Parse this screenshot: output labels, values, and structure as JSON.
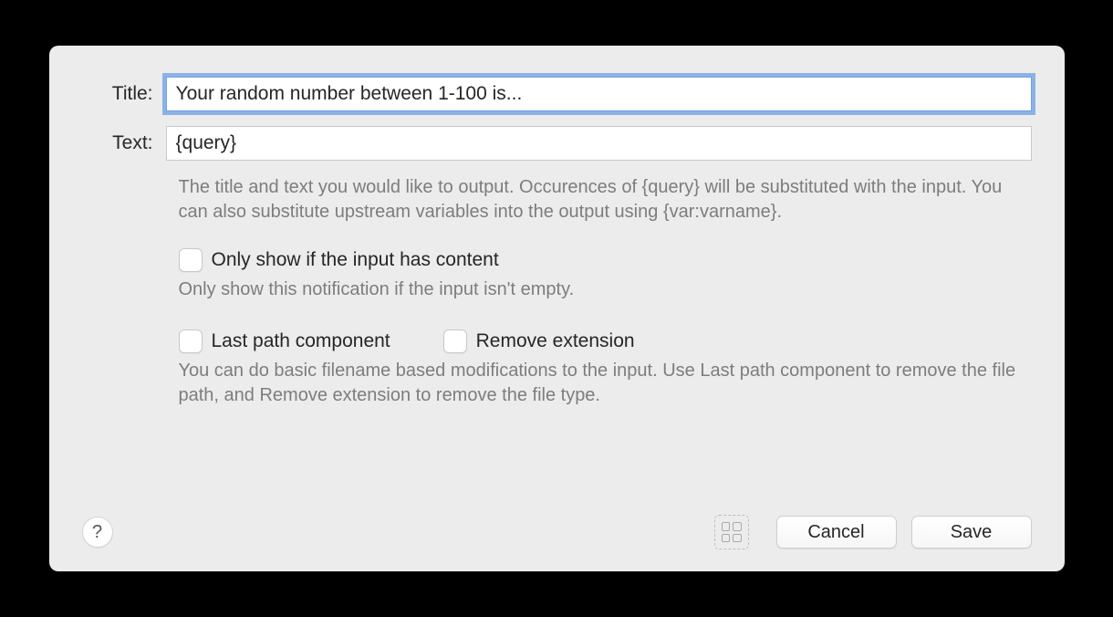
{
  "form": {
    "title_label": "Title:",
    "title_value": "Your random number between 1-100 is...",
    "text_label": "Text:",
    "text_value": "{query}",
    "help_output": "The title and text you would like to output. Occurences of {query} will be substituted with the input. You can also substitute upstream variables into the output using {var:varname}.",
    "only_show_label": "Only show if the input has content",
    "only_show_help": "Only show this notification if the input isn't empty.",
    "last_path_label": "Last path component",
    "remove_ext_label": "Remove extension",
    "filename_help": "You can do basic filename based modifications to the input. Use Last path component to remove the file path, and Remove extension to remove the file type."
  },
  "buttons": {
    "help": "?",
    "cancel": "Cancel",
    "save": "Save"
  }
}
